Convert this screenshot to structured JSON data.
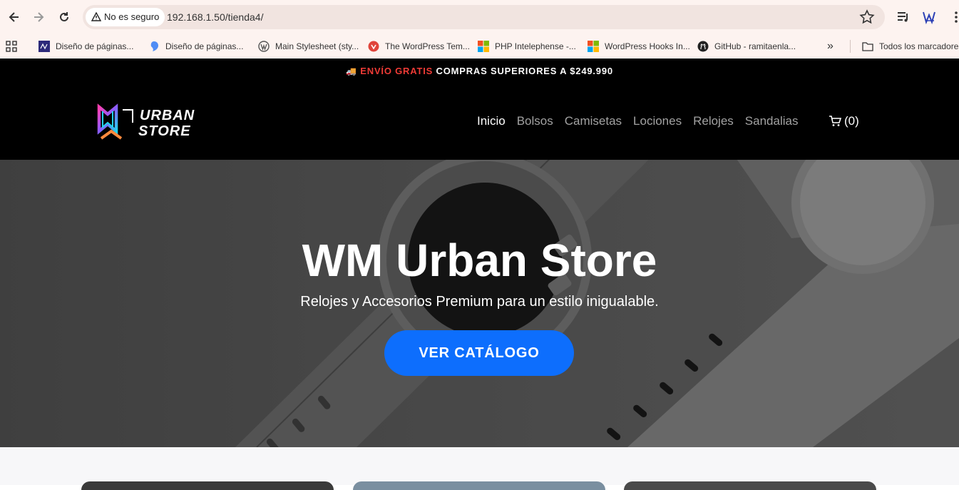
{
  "browser": {
    "security_label": "No es seguro",
    "url": "192.168.1.50/tienda4/",
    "bookmarks": [
      {
        "label": "Diseño de páginas...",
        "icon": "site-favicon"
      },
      {
        "label": "Diseño de páginas...",
        "icon": "blue-drop-favicon"
      },
      {
        "label": "Main Stylesheet (sty...",
        "icon": "wordpress-icon"
      },
      {
        "label": "The WordPress Tem...",
        "icon": "red-circle-favicon"
      },
      {
        "label": "PHP Intelephense -...",
        "icon": "microsoft-icon"
      },
      {
        "label": "WordPress Hooks In...",
        "icon": "microsoft-icon"
      },
      {
        "label": "GitHub - ramitaenla...",
        "icon": "github-icon"
      }
    ],
    "more_bookmarks": "»",
    "all_bookmarks_label": "Todos los marcadores"
  },
  "promo": {
    "icon": "🚚",
    "highlight": "ENVÍO GRATIS",
    "text": "COMPRAS SUPERIORES A $249.990"
  },
  "site": {
    "logo_text_top": "URBAN",
    "logo_text_bottom": "STORE",
    "menu": [
      {
        "label": "Inicio",
        "active": true
      },
      {
        "label": "Bolsos",
        "active": false
      },
      {
        "label": "Camisetas",
        "active": false
      },
      {
        "label": "Lociones",
        "active": false
      },
      {
        "label": "Relojes",
        "active": false
      },
      {
        "label": "Sandalias",
        "active": false
      }
    ],
    "cart_count": "(0)"
  },
  "hero": {
    "title": "WM Urban Store",
    "subtitle": "Relojes y Accesorios Premium para un estilo inigualable.",
    "cta": "VER CATÁLOGO"
  },
  "colors": {
    "accent": "#0d6efd",
    "promo_accent": "#ef3b36",
    "header_bg": "#000000"
  }
}
